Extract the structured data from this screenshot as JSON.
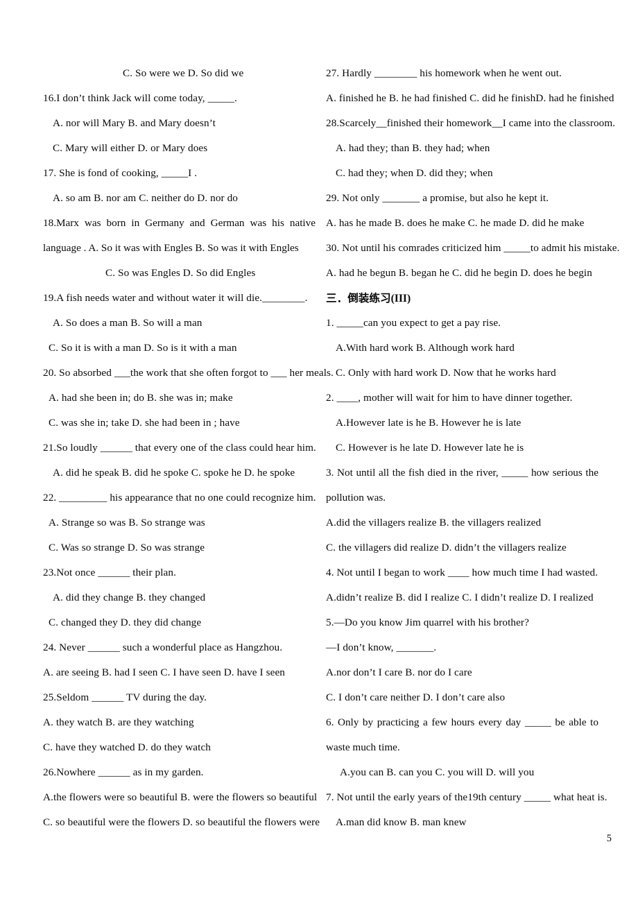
{
  "document": {
    "page_number": "5",
    "section_heading": {
      "prefix": "三．",
      "title": "倒装练习",
      "roman": "(III)"
    }
  },
  "left_column": {
    "lines": [
      {
        "id": "q15-options-cd",
        "indent": "i14",
        "text": "C. So were we         D. So did we"
      },
      {
        "id": "q16-stem",
        "indent": "i0",
        "text": "16.I don’t think Jack will come today, _____."
      },
      {
        "id": "q16-options-ab",
        "indent": "i2",
        "text": "A. nor will Mary        B. and Mary doesn’t"
      },
      {
        "id": "q16-options-cd",
        "indent": "i2",
        "text": "C. Mary will either        D. or Mary does"
      },
      {
        "id": "q17-stem",
        "indent": "i0",
        "text": "17. She is fond of cooking, _____I ."
      },
      {
        "id": "q17-options",
        "indent": "i2",
        "text": "A. so am     B. nor am     C. neither do     D. nor do"
      },
      {
        "id": "q18-stem",
        "indent": "i0",
        "text": "18.Marx was born in Germany and German was his native language .    A. So it was with Engles        B. So was it with Engles"
      },
      {
        "id": "q18-options-cd",
        "indent": "i18",
        "text": "C. So was Engles                D. So did Engles"
      },
      {
        "id": "q19-stem",
        "indent": "i0",
        "text": "19.A fish needs water and without water it will die.________."
      },
      {
        "id": "q19-options-ab",
        "indent": "i2",
        "text": "A. So does a man            B. So will a man"
      },
      {
        "id": "q19-options-cd",
        "indent": "i1",
        "text": "C. So it is with a man     D. So is it with a man"
      },
      {
        "id": "q20-stem",
        "indent": "i0",
        "text": "20. So absorbed ___the work that she often forgot to ___ her meals."
      },
      {
        "id": "q20-options-ab",
        "indent": "i1",
        "text": "A. had she been in; do           B. she was in; make"
      },
      {
        "id": "q20-options-cd",
        "indent": "i1",
        "text": "C. was she in; take             D. she had been in ; have"
      },
      {
        "id": "q21-stem",
        "indent": "i0",
        "text": "21.So loudly ______ that every one of the class could hear him."
      },
      {
        "id": "q21-options",
        "indent": "i2",
        "text": "A. did he speak    B. did he spoke    C. spoke he     D. he spoke"
      },
      {
        "id": "q22-stem",
        "indent": "i0",
        "text": "22. _________ his appearance that no one could recognize him."
      },
      {
        "id": "q22-options-ab",
        "indent": "i1",
        "text": "A. Strange so was         B. So strange was"
      },
      {
        "id": "q22-options-cd",
        "indent": "i1",
        "text": "C. Was so strange      D. So was strange"
      },
      {
        "id": "q23-stem",
        "indent": "i0",
        "text": "23.Not once ______ their plan."
      },
      {
        "id": "q23-options-ab",
        "indent": "i2",
        "text": "A. did they change        B. they changed"
      },
      {
        "id": "q23-options-cd",
        "indent": "i1",
        "text": "C. changed they          D. they did change"
      },
      {
        "id": "q24-stem",
        "indent": "i0",
        "text": "24. Never ______ such a wonderful place as Hangzhou."
      },
      {
        "id": "q24-options",
        "indent": "i0",
        "text": "A. are seeing     B. had I seen    C. I have seen      D. have I seen"
      },
      {
        "id": "q25-stem",
        "indent": "i0",
        "text": "25.Seldom ______ TV during the day."
      },
      {
        "id": "q25-options-ab",
        "indent": "i0",
        "text": "A. they watch                B. are they watching"
      },
      {
        "id": "q25-options-cd",
        "indent": "i0",
        "text": "C. have they watched        D. do they watch"
      },
      {
        "id": "q26-stem",
        "indent": "i0",
        "text": "26.Nowhere ______ as in my garden."
      },
      {
        "id": "q26-options-ab",
        "indent": "i0",
        "text": "A.the flowers were so beautiful     B. were the flowers so beautiful"
      },
      {
        "id": "q26-options-cd",
        "indent": "i0",
        "text": "C. so beautiful were the flowers   D. so beautiful the flowers were"
      }
    ]
  },
  "right_column": {
    "lines_before_heading": [
      {
        "id": "q27-stem",
        "indent": "i0",
        "text": "27. Hardly ________ his homework when he went out."
      },
      {
        "id": "q27-options",
        "indent": "i0",
        "text": "A. finished he B. he had finished C. did he finishD. had he finished"
      },
      {
        "id": "q28-stem",
        "indent": "i0",
        "text": "28.Scarcely__finished their homework__I came into the classroom."
      },
      {
        "id": "q28-options-ab",
        "indent": "i2",
        "text": "A. had they; than        B. they had; when"
      },
      {
        "id": "q28-options-cd",
        "indent": "i2",
        "text": "C. had they; when    D. did they; when"
      },
      {
        "id": "q29-stem",
        "indent": "i0",
        "text": "29. Not only _______ a promise, but also he kept it."
      },
      {
        "id": "q29-options",
        "indent": "i0",
        "text": "A. has he made   B. does he make   C. he made   D. did he make"
      },
      {
        "id": "q30-stem",
        "indent": "i0",
        "text": "30. Not until his comrades criticized him _____to admit his mistake."
      },
      {
        "id": "q30-options",
        "indent": "i0",
        "text": "A. had he begun  B. began he   C. did he begin  D. does he begin"
      }
    ],
    "lines_after_heading": [
      {
        "id": "s3-q1-stem",
        "indent": "i0",
        "text": "1. _____can you expect to get a pay rise."
      },
      {
        "id": "s3-q1-options-ab",
        "indent": "i2",
        "text": "A.With hard work        B. Although work hard"
      },
      {
        "id": "s3-q1-options-cd",
        "indent": "i2",
        "text": "C. Only with hard work   D. Now that he works hard"
      },
      {
        "id": "s3-q2-stem",
        "indent": "i0",
        "text": "2. ____, mother will wait for him to have dinner together."
      },
      {
        "id": "s3-q2-options-ab",
        "indent": "i2",
        "text": "A.However late is he         B. However he is late"
      },
      {
        "id": "s3-q2-options-cd",
        "indent": "i2",
        "text": "C. However is he late        D. However late he is"
      },
      {
        "id": "s3-q3-stem",
        "indent": "i0",
        "text": "3. Not until all the fish died in the river, _____ how serious the pollution was."
      },
      {
        "id": "s3-q3-options-ab",
        "indent": "i0",
        "text": "A.did the villagers realize     B. the villagers realized"
      },
      {
        "id": "s3-q3-options-cd",
        "indent": "i0",
        "text": "C. the villagers did realize    D. didn’t the villagers realize"
      },
      {
        "id": "s3-q4-stem",
        "indent": "i0",
        "text": "4. Not until I began to work ____ how much time I had wasted."
      },
      {
        "id": "s3-q4-options",
        "indent": "i0",
        "text": "A.didn’t realize  B. did I realize  C. I didn’t realize  D. I realized"
      },
      {
        "id": "s3-q5-stem",
        "indent": "i0",
        "text": "5.—Do you know Jim quarrel with his brother?"
      },
      {
        "id": "s3-q5-reply",
        "indent": "i0",
        "text": "—I don’t know, _______."
      },
      {
        "id": "s3-q5-options-ab",
        "indent": "i0",
        "text": "A.nor don’t I care            B. nor do I care"
      },
      {
        "id": "s3-q5-options-cd",
        "indent": "i0",
        "text": "C. I don’t care neither      D. I don’t care also"
      },
      {
        "id": "s3-q6-stem",
        "indent": "i0",
        "text": "6. Only by practicing a few hours every day _____ be able to waste much time."
      },
      {
        "id": "s3-q6-options",
        "indent": "i3",
        "text": "A.you can     B. can you    C. you will  D. will you"
      },
      {
        "id": "s3-q7-stem",
        "indent": "i0",
        "text": "7. Not until the early years of the19th century _____ what heat is."
      },
      {
        "id": "s3-q7-options-ab",
        "indent": "i2",
        "text": "A.man did know        B. man knew"
      }
    ]
  }
}
